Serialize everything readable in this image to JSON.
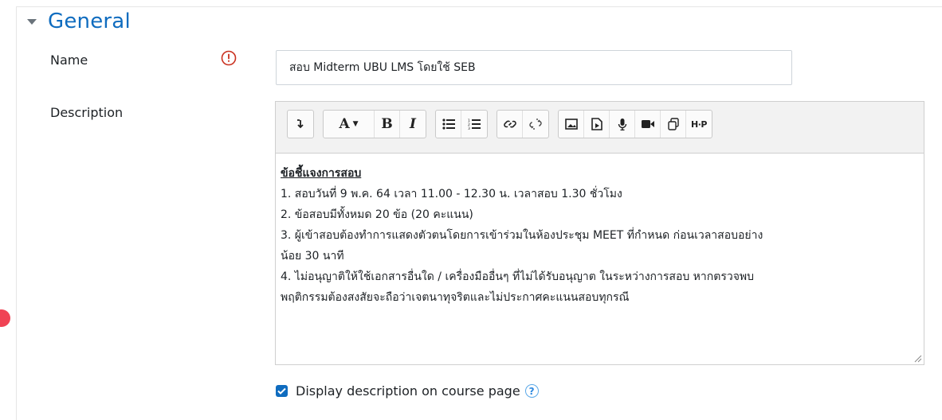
{
  "section": {
    "title": "General"
  },
  "name_field": {
    "label": "Name",
    "value": "สอบ Midterm UBU LMS โดยใช้ SEB"
  },
  "description_field": {
    "label": "Description",
    "toolbar": {
      "groups": [
        [
          "collapse-icon"
        ],
        [
          "font-color-icon",
          "bold-icon",
          "italic-icon"
        ],
        [
          "bulleted-list-icon",
          "numbered-list-icon"
        ],
        [
          "link-icon",
          "unlink-icon"
        ],
        [
          "image-icon",
          "media-icon",
          "record-audio-icon",
          "record-video-icon",
          "manage-files-icon",
          "h5p-icon"
        ]
      ],
      "labels": {
        "bold": "B",
        "italic": "I",
        "font": "A",
        "h5p": "H·P"
      }
    },
    "content": {
      "heading": "ข้อชี้แจงการสอบ",
      "lines": [
        "1.  สอบวันที่ 9 พ.ค. 64 เวลา 11.00 - 12.30 น.  เวลาสอบ 1.30 ชั่วโมง",
        "2. ข้อสอบมีทั้งหมด 20 ข้อ (20 คะแนน)",
        "3. ผู้เข้าสอบต้องทำการแสดงตัวตนโดยการเข้าร่วมในห้องประชุม MEET ที่กำหนด ก่อนเวลาสอบอย่าง",
        "น้อย 30 นาที",
        "4. ไม่อนุญาติให้ใช้เอกสารอื่นใด / เครื่องมืออื่นๆ ที่ไม่ได้รับอนุญาต ในระหว่างการสอบ หากตรวจพบ",
        "พฤติกรรมต้องสงสัยจะถือว่าเจตนาทุจริตและไม่ประกาศคะแนนสอบทุกรณี"
      ]
    }
  },
  "display_description": {
    "label": "Display description on course page",
    "checked": true,
    "help": "?"
  },
  "colors": {
    "accent": "#0f6cbf",
    "required": "#ca3120",
    "dot": "#f04354"
  }
}
